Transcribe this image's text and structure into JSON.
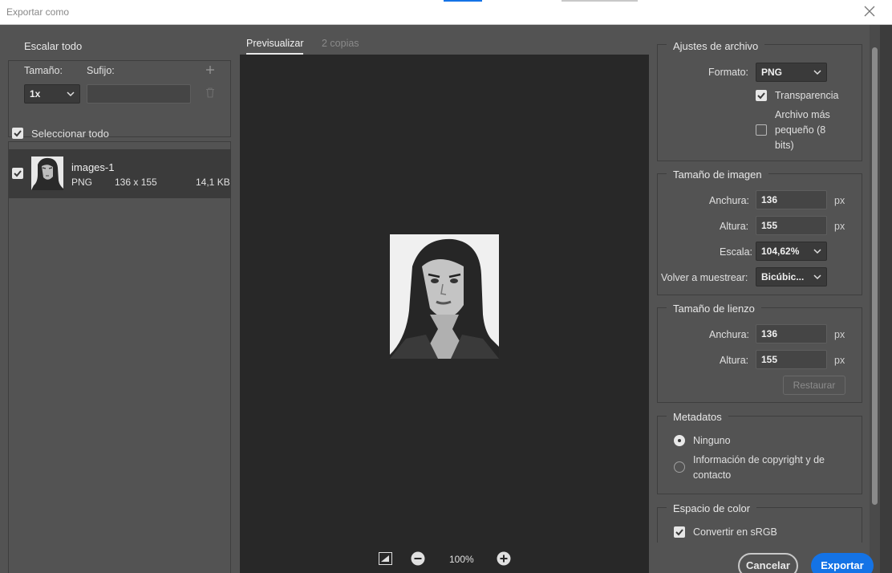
{
  "window": {
    "title": "Exportar como"
  },
  "left": {
    "scale_all": "Escalar todo",
    "size_label": "Tamaño:",
    "suffix_label": "Sufijo:",
    "size_value": "1x",
    "suffix_value": "",
    "select_all": "Seleccionar todo",
    "asset": {
      "name": "images-1",
      "format": "PNG",
      "dims": "136 x 155",
      "filesize": "14,1 KB"
    }
  },
  "center": {
    "tab_preview": "Previsualizar",
    "tab_copies": "2 copias",
    "zoom_level": "100%"
  },
  "right": {
    "file_settings": {
      "title": "Ajustes de archivo",
      "format_label": "Formato:",
      "format_value": "PNG",
      "transparency": "Transparencia",
      "smaller_file": [
        "Archivo más",
        "pequeño (8",
        "bits)"
      ]
    },
    "image_size": {
      "title": "Tamaño de imagen",
      "width_label": "Anchura:",
      "width_value": "136",
      "height_label": "Altura:",
      "height_value": "155",
      "scale_label": "Escala:",
      "scale_value": "104,62%",
      "resample_label": "Volver a muestrear:",
      "resample_value": "Bicúbic...",
      "unit": "px"
    },
    "canvas_size": {
      "title": "Tamaño de lienzo",
      "width_label": "Anchura:",
      "width_value": "136",
      "height_label": "Altura:",
      "height_value": "155",
      "unit": "px",
      "restore": "Restaurar"
    },
    "metadata": {
      "title": "Metadatos",
      "none": "Ninguno",
      "copyright": [
        "Información de copyright y de",
        "contacto"
      ]
    },
    "color_space": {
      "title": "Espacio de color",
      "convert_srgb": "Convertir en sRGB"
    }
  },
  "buttons": {
    "cancel": "Cancelar",
    "export": "Exportar"
  },
  "colors": {
    "accent": "#1473e6",
    "panel": "#535353",
    "preview_bg": "#282828"
  },
  "icons": [
    "close-icon",
    "plus-icon",
    "trash-icon",
    "chevron-down-icon",
    "checkmark-icon",
    "fit-screen-icon",
    "zoom-out-icon",
    "zoom-in-icon"
  ]
}
